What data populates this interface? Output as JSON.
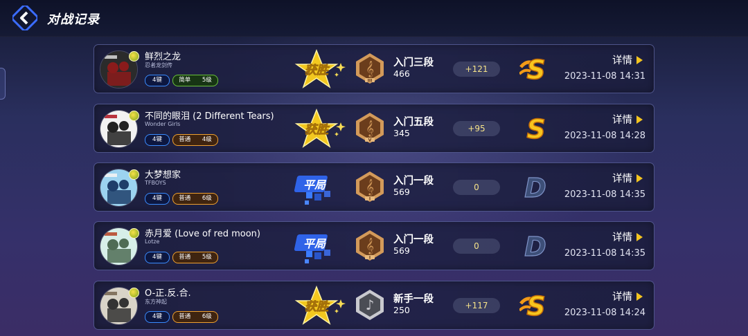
{
  "header": {
    "title": "对战记录"
  },
  "labels": {
    "detail": "详情"
  },
  "colors": {
    "accent_gold": "#f3c420",
    "key_blue": "#3a8cff",
    "easy_green": "#6ac23a",
    "normal_orange": "#f0a12f"
  },
  "records": [
    {
      "title": "鲜烈之龙",
      "artist": "忍者龙剑传",
      "keys": "4键",
      "difficulty": "简单",
      "level": "5级",
      "diff_type": "easy",
      "result": "获胜",
      "result_type": "win",
      "rank_tier": "bronze",
      "rank_roman": "III",
      "rank_name": "入门三段",
      "rank_score": "466",
      "delta": "+121",
      "grade": "S",
      "grade_type": "s-plus",
      "time": "2023-11-08 14:31",
      "cover_icon": "album-cover-dark"
    },
    {
      "title": "不同的眼泪 (2 Different Tears)",
      "artist": "Wonder Girls",
      "keys": "4键",
      "difficulty": "普通",
      "level": "4级",
      "diff_type": "normal",
      "result": "获胜",
      "result_type": "win",
      "rank_tier": "bronze",
      "rank_roman": "V",
      "rank_name": "入门五段",
      "rank_score": "345",
      "delta": "+95",
      "grade": "S",
      "grade_type": "s",
      "time": "2023-11-08 14:28",
      "cover_icon": "album-cover-group"
    },
    {
      "title": "大梦想家",
      "artist": "TFBOYS",
      "keys": "4键",
      "difficulty": "普通",
      "level": "6级",
      "diff_type": "normal",
      "result": "平局",
      "result_type": "draw",
      "rank_tier": "bronze",
      "rank_roman": "I",
      "rank_name": "入门一段",
      "rank_score": "569",
      "delta": "0",
      "grade": "D",
      "grade_type": "d",
      "time": "2023-11-08 14:35",
      "cover_icon": "album-cover-sky"
    },
    {
      "title": "赤月爱 (Love of red moon)",
      "artist": "Lotze",
      "keys": "4键",
      "difficulty": "普通",
      "level": "5级",
      "diff_type": "normal",
      "result": "平局",
      "result_type": "draw",
      "rank_tier": "bronze",
      "rank_roman": "I",
      "rank_name": "入门一段",
      "rank_score": "569",
      "delta": "0",
      "grade": "D",
      "grade_type": "d",
      "time": "2023-11-08 14:35",
      "cover_icon": "album-cover-moon"
    },
    {
      "title": "O-正.反.合.",
      "artist": "东方神起",
      "keys": "4键",
      "difficulty": "普通",
      "level": "6级",
      "diff_type": "normal",
      "result": "获胜",
      "result_type": "win",
      "rank_tier": "silver",
      "rank_roman": "",
      "rank_name": "新手一段",
      "rank_score": "250",
      "delta": "+117",
      "grade": "S",
      "grade_type": "s-plus",
      "time": "2023-11-08 14:24",
      "cover_icon": "album-cover-band"
    }
  ]
}
